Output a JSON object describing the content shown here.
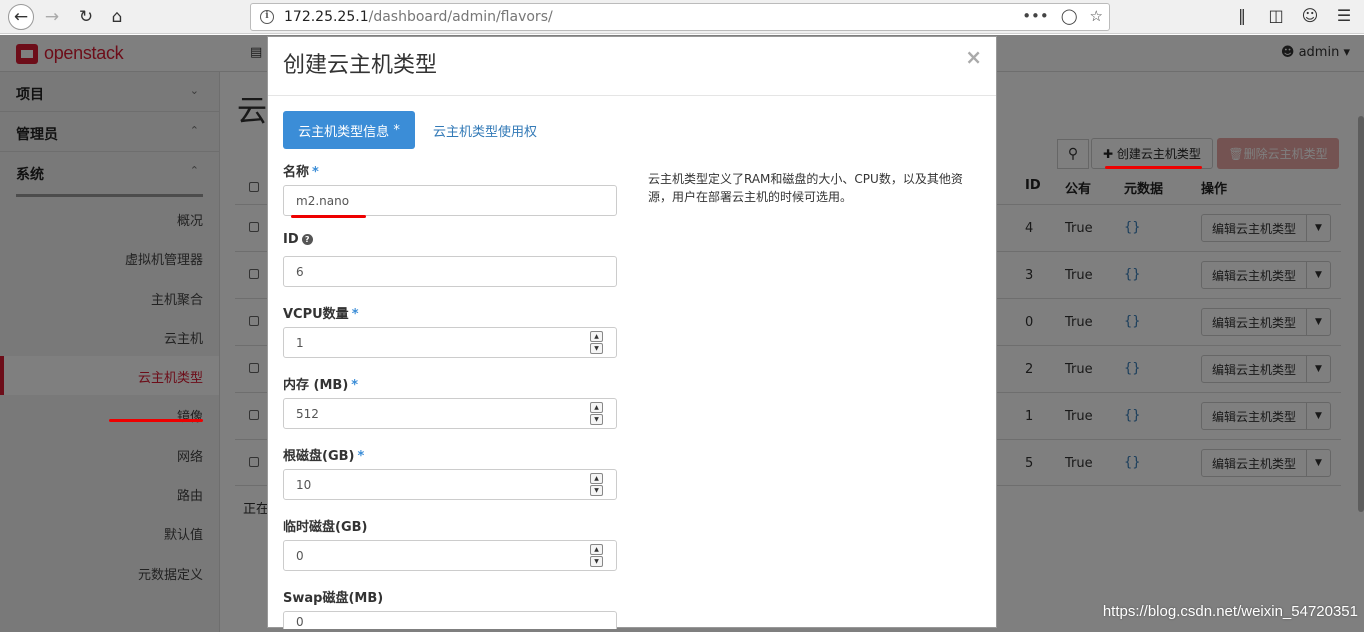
{
  "browser": {
    "url_host": "172.25.25.1",
    "url_path": "/dashboard/admin/flavors/",
    "url_actions": "•••"
  },
  "header": {
    "logo_text": "openstack",
    "user": "admin"
  },
  "sidebar": {
    "sections": [
      {
        "label": "项目"
      },
      {
        "label": "管理员"
      },
      {
        "label": "系统"
      }
    ],
    "items": [
      {
        "label": "概况"
      },
      {
        "label": "虚拟机管理器"
      },
      {
        "label": "主机聚合"
      },
      {
        "label": "云主机"
      },
      {
        "label": "云主机类型"
      },
      {
        "label": "镜像"
      },
      {
        "label": "网络"
      },
      {
        "label": "路由"
      },
      {
        "label": "默认值"
      },
      {
        "label": "元数据定义"
      }
    ],
    "active_index": 4
  },
  "main": {
    "title_partial": "云",
    "create_button": "创建云主机类型",
    "delete_button": "删除云主机类型",
    "columns": {
      "id": "ID",
      "public": "公有",
      "metadata": "元数据",
      "actions": "操作"
    },
    "rows": [
      {
        "id": "4",
        "public": "True",
        "metadata": "{}",
        "action": "编辑云主机类型"
      },
      {
        "id": "3",
        "public": "True",
        "metadata": "{}",
        "action": "编辑云主机类型"
      },
      {
        "id": "0",
        "public": "True",
        "metadata": "{}",
        "action": "编辑云主机类型"
      },
      {
        "id": "2",
        "public": "True",
        "metadata": "{}",
        "action": "编辑云主机类型"
      },
      {
        "id": "1",
        "public": "True",
        "metadata": "{}",
        "action": "编辑云主机类型"
      },
      {
        "id": "5",
        "public": "True",
        "metadata": "{}",
        "action": "编辑云主机类型"
      }
    ],
    "status_partial": "正在"
  },
  "modal": {
    "title": "创建云主机类型",
    "close": "×",
    "tab_info": "云主机类型信息",
    "tab_access": "云主机类型使用权",
    "required_mark": "*",
    "description": "云主机类型定义了RAM和磁盘的大小、CPU数，以及其他资源，用户在部署云主机的时候可选用。",
    "fields": {
      "name": {
        "label": "名称",
        "value": "m2.nano"
      },
      "id": {
        "label": "ID",
        "value": "6"
      },
      "vcpu": {
        "label": "VCPU数量",
        "value": "1"
      },
      "ram": {
        "label": "内存 (MB)",
        "value": "512"
      },
      "disk": {
        "label": "根磁盘(GB)",
        "value": "10"
      },
      "ephemeral": {
        "label": "临时磁盘(GB)",
        "value": "0"
      },
      "swap": {
        "label": "Swap磁盘(MB)",
        "value": "0"
      }
    }
  },
  "watermark": "https://blog.csdn.net/weixin_54720351"
}
